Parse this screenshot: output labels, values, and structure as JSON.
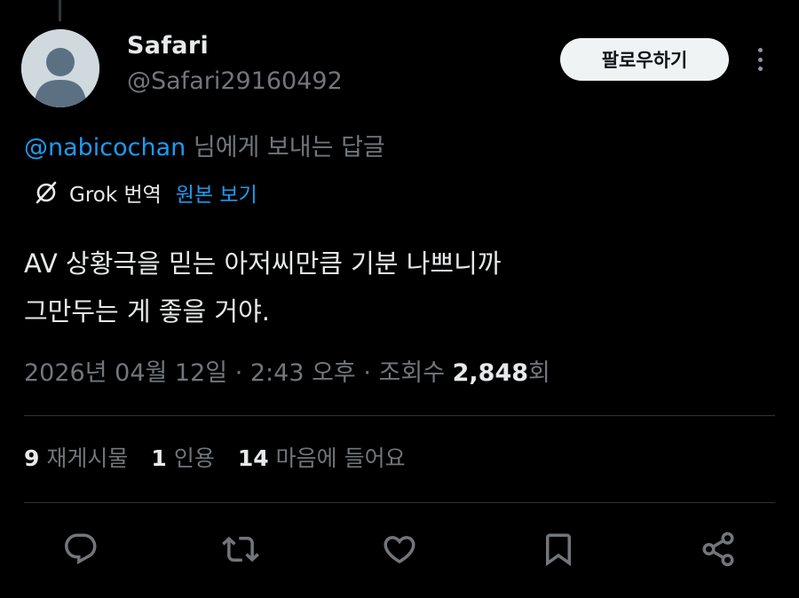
{
  "author": {
    "display_name": "Safari",
    "handle": "@Safari29160492"
  },
  "follow_button": {
    "label": "팔로우하기"
  },
  "reply_context": {
    "mention": "@nabicochan",
    "suffix": " 님에게 보내는 답글"
  },
  "translation": {
    "grok_label": "Grok 번역",
    "show_original_label": "원본 보기"
  },
  "tweet": {
    "lines": [
      "AV 상황극을 믿는 아저씨만큼 기분 나쁘니까",
      "그만두는 게 좋을 거야."
    ]
  },
  "meta": {
    "date": "2026년 04월 12일",
    "separator": " · ",
    "time": "2:43 오후",
    "views_label": "조회수 ",
    "views_count": "2,848",
    "views_suffix": "회"
  },
  "stats": {
    "reposts": {
      "count": "9",
      "label": "재게시물"
    },
    "quotes": {
      "count": "1",
      "label": "인용"
    },
    "likes": {
      "count": "14",
      "label": "마음에 들어요"
    }
  },
  "actions": [
    "reply-icon",
    "repost-icon",
    "like-icon",
    "bookmark-icon",
    "share-icon"
  ],
  "colors": {
    "background": "#000000",
    "text": "#e7e9ea",
    "secondary": "#71767b",
    "accent": "#1d9bf0",
    "follow_bg": "#eff3f4"
  }
}
